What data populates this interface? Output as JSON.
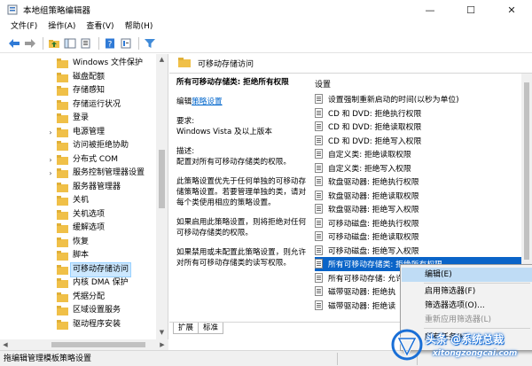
{
  "window": {
    "title": "本地组策略编辑器",
    "controls": {
      "minimize": "—",
      "maximize": "☐",
      "close": "✕"
    }
  },
  "menubar": {
    "items": [
      "文件(F)",
      "操作(A)",
      "查看(V)",
      "帮助(H)"
    ]
  },
  "toolbar": {
    "icons": [
      "back-icon",
      "forward-icon",
      "up-folder-icon",
      "show-hide-tree-icon",
      "export-list-icon",
      "help-icon",
      "properties-icon",
      "filter-icon"
    ]
  },
  "tree": {
    "items": [
      {
        "label": "Windows 文件保护",
        "expandable": false
      },
      {
        "label": "磁盘配额",
        "expandable": false
      },
      {
        "label": "存储感知",
        "expandable": false
      },
      {
        "label": "存储运行状况",
        "expandable": false
      },
      {
        "label": "登录",
        "expandable": false
      },
      {
        "label": "电源管理",
        "expandable": true
      },
      {
        "label": "访问被拒绝协助",
        "expandable": false
      },
      {
        "label": "分布式 COM",
        "expandable": true
      },
      {
        "label": "服务控制管理器设置",
        "expandable": true
      },
      {
        "label": "服务器管理器",
        "expandable": false
      },
      {
        "label": "关机",
        "expandable": false
      },
      {
        "label": "关机选项",
        "expandable": false
      },
      {
        "label": "缓解选项",
        "expandable": false
      },
      {
        "label": "恢复",
        "expandable": false
      },
      {
        "label": "脚本",
        "expandable": false
      },
      {
        "label": "可移动存储访问",
        "expandable": false,
        "selected": true
      },
      {
        "label": "内核 DMA 保护",
        "expandable": false
      },
      {
        "label": "凭据分配",
        "expandable": false
      },
      {
        "label": "区域设置服务",
        "expandable": false
      },
      {
        "label": "驱动程序安装",
        "expandable": false
      }
    ]
  },
  "right": {
    "header": "可移动存储访问",
    "description": {
      "title": "所有可移动存储类: 拒绝所有权限",
      "edit_prefix": "编辑",
      "edit_link": "策略设置",
      "requirement_label": "要求:",
      "requirement_value": "Windows Vista 及以上版本",
      "desc_label": "描述:",
      "desc_text": "配置对所有可移动存储类的权限。",
      "para1": "此策略设置优先于任何单独的可移动存储策略设置。若要管理单独的类，请对每个类使用相应的策略设置。",
      "para2": "如果启用此策略设置，则将拒绝对任何可移动存储类的权限。",
      "para3": "如果禁用或未配置此策略设置，则允许对所有可移动存储类的读写权限。"
    },
    "column_header": "设置",
    "settings": [
      "设置强制重新启动的时间(以秒为单位)",
      "CD 和 DVD: 拒绝执行权限",
      "CD 和 DVD: 拒绝读取权限",
      "CD 和 DVD: 拒绝写入权限",
      "自定义类: 拒绝读取权限",
      "自定义类: 拒绝写入权限",
      "软盘驱动器: 拒绝执行权限",
      "软盘驱动器: 拒绝读取权限",
      "软盘驱动器: 拒绝写入权限",
      "可移动磁盘: 拒绝执行权限",
      "可移动磁盘: 拒绝读取权限",
      "可移动磁盘: 拒绝写入权限",
      "所有可移动存储类: 拒绝所有权限",
      "所有可移动存储: 允许",
      "磁带驱动器: 拒绝执",
      "磁带驱动器: 拒绝读"
    ],
    "selected_index": 12,
    "tabs": [
      "扩展",
      "标准"
    ]
  },
  "context_menu": {
    "items": [
      {
        "label": "编辑(E)",
        "highlighted": true,
        "disabled": false
      },
      {
        "label": "启用筛选器(F)",
        "highlighted": false,
        "disabled": false
      },
      {
        "label": "筛选器选项(O)...",
        "highlighted": false,
        "disabled": false
      },
      {
        "label": "重新应用筛选器(L)",
        "highlighted": false,
        "disabled": true
      },
      {
        "label": "所有任务(K)",
        "highlighted": false,
        "disabled": false
      }
    ]
  },
  "statusbar": {
    "text": "拖编辑管理模板策略设置"
  },
  "watermark": {
    "line1": "头条 @系统总裁",
    "line2": "xitongzongcai.com"
  },
  "colors": {
    "selection": "#0a64c8",
    "tree_selection": "#cce8ff",
    "folder": "#f0c048",
    "link": "#0066cc",
    "menu_highlight": "#bfdcf5"
  }
}
